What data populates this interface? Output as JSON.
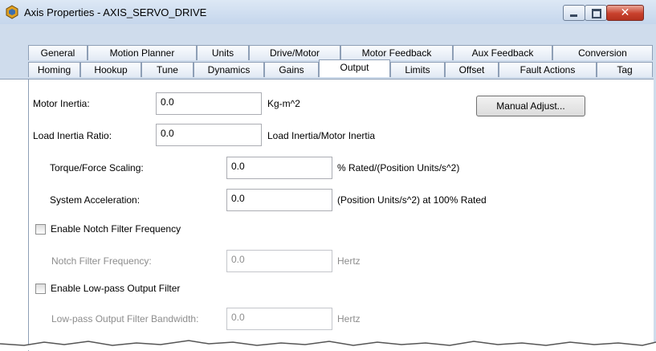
{
  "window": {
    "title": "Axis Properties - AXIS_SERVO_DRIVE",
    "app_icon": "axis-properties-icon",
    "controls": {
      "minimize_icon": "minimize-icon",
      "maximize_icon": "maximize-icon",
      "close_icon": "close-icon",
      "close_glyph": "✕"
    }
  },
  "tabs_row1": [
    "General",
    "Motion Planner",
    "Units",
    "Drive/Motor",
    "Motor Feedback",
    "Aux Feedback",
    "Conversion"
  ],
  "tabs_row2": [
    "Homing",
    "Hookup",
    "Tune",
    "Dynamics",
    "Gains",
    "Output",
    "Limits",
    "Offset",
    "Fault Actions",
    "Tag"
  ],
  "active_tab": "Output",
  "form": {
    "motor_inertia": {
      "label": "Motor Inertia:",
      "value": "0.0",
      "unit": "Kg-m^2"
    },
    "manual_adjust_button": "Manual Adjust...",
    "load_inertia_ratio": {
      "label": "Load Inertia Ratio:",
      "value": "0.0",
      "unit": "Load Inertia/Motor Inertia"
    },
    "torque_force_scaling": {
      "label": "Torque/Force Scaling:",
      "value": "0.0",
      "unit": "% Rated/(Position Units/s^2)"
    },
    "system_acceleration": {
      "label": "System Acceleration:",
      "value": "0.0",
      "unit": "(Position Units/s^2) at 100% Rated"
    },
    "enable_notch_filter": {
      "label": "Enable Notch Filter Frequency",
      "checked": false
    },
    "notch_filter_frequency": {
      "label": "Notch Filter Frequency:",
      "value": "0.0",
      "unit": "Hertz",
      "enabled": false
    },
    "enable_lowpass_filter": {
      "label": "Enable Low-pass Output Filter",
      "checked": false
    },
    "lowpass_bandwidth": {
      "label": "Low-pass Output Filter Bandwidth:",
      "value": "0.0",
      "unit": "Hertz",
      "enabled": false
    }
  },
  "colors": {
    "window_frame": "#cfdcec",
    "close_button": "#c8402c",
    "disabled_text": "#8d8d8d"
  }
}
